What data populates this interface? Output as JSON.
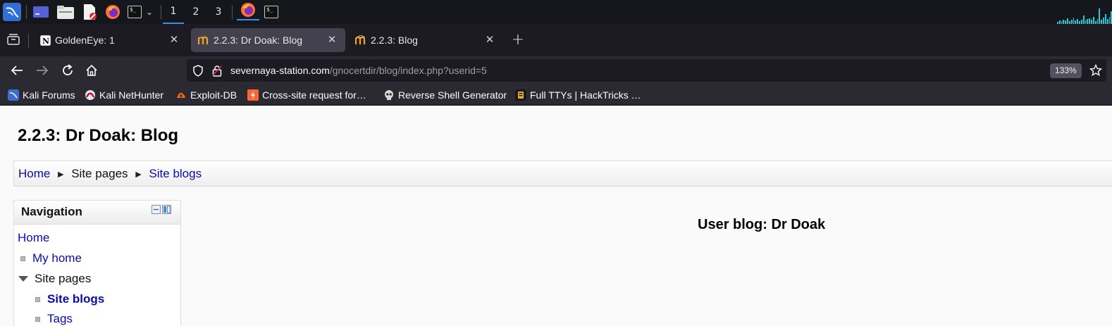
{
  "panel": {
    "workspaces": [
      "1",
      "2",
      "3"
    ],
    "active_workspace": "1"
  },
  "tabs": [
    {
      "title": "GoldenEye: 1",
      "icon": "notion-icon",
      "selected": false
    },
    {
      "title": "2.2.3: Dr Doak: Blog",
      "icon": "moodle-icon",
      "selected": true
    },
    {
      "title": "2.2.3: Blog",
      "icon": "moodle-icon",
      "selected": false
    }
  ],
  "address": {
    "host": "severnaya-station.com",
    "path": "/gnocertdir/blog/index.php?userid=5",
    "zoom": "133%"
  },
  "bookmarks": [
    {
      "label": "Kali Forums",
      "icon": "kali-forums-icon"
    },
    {
      "label": "Kali NetHunter",
      "icon": "nethunter-icon"
    },
    {
      "label": "Exploit-DB",
      "icon": "exploitdb-icon"
    },
    {
      "label": "Cross-site request for…",
      "icon": "portswigger-icon"
    },
    {
      "label": "Reverse Shell Generator",
      "icon": "skull-icon"
    },
    {
      "label": "Full TTYs | HackTricks …",
      "icon": "hacktricks-icon"
    }
  ],
  "page": {
    "title": "2.2.3: Dr Doak: Blog",
    "breadcrumb": [
      "Home",
      "Site pages",
      "Site blogs"
    ],
    "navigation": {
      "title": "Navigation",
      "items": [
        "Home",
        "My home",
        "Site pages",
        "Site blogs",
        "Tags"
      ]
    },
    "main_heading": "User blog: Dr Doak"
  },
  "colors": {
    "link": "#0b0ba8",
    "tab_selected": "#42414d",
    "toolbar": "#2b2a33",
    "panel": "#15171c"
  }
}
